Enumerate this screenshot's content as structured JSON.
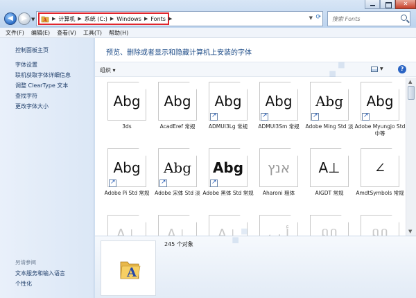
{
  "address_bar": {
    "crumbs": [
      "计算机",
      "系统 (C:)",
      "Windows",
      "Fonts"
    ]
  },
  "search": {
    "placeholder": "搜索 Fonts"
  },
  "menu": [
    "文件(F)",
    "编辑(E)",
    "查看(V)",
    "工具(T)",
    "帮助(H)"
  ],
  "sidebar": {
    "top_links": [
      "控制面板主页"
    ],
    "links": [
      "字体设置",
      "联机获取字体详细信息",
      "调整 ClearType 文本",
      "查找字符",
      "更改字体大小"
    ],
    "see_also_title": "另请参阅",
    "see_also": [
      "文本服务和输入语言",
      "个性化"
    ]
  },
  "main": {
    "heading": "预览、删除或者显示和隐藏计算机上安装的字体",
    "organize_label": "组织",
    "status_count": "245 个对象"
  },
  "fonts": [
    {
      "sample": "Abg",
      "label": "3ds",
      "stack": true,
      "shortcut": false
    },
    {
      "sample": "Abg",
      "label": "AcadEref 常规",
      "stack": false,
      "shortcut": false
    },
    {
      "sample": "Abg",
      "label": "ADMUI3Lg 常规",
      "stack": false,
      "shortcut": true
    },
    {
      "sample": "Abg",
      "label": "ADMUI3Sm 常规",
      "stack": false,
      "shortcut": true
    },
    {
      "sample": "Abg",
      "label": "Adobe Ming Std 淡",
      "stack": false,
      "shortcut": true
    },
    {
      "sample": "Abg",
      "label": "Adobe Myungjo Std 中等",
      "stack": false,
      "shortcut": true
    },
    {
      "sample": "Abg",
      "label": "Adobe Pi Std 常规",
      "stack": false,
      "shortcut": true
    },
    {
      "sample": "Abg",
      "label": "Adobe 宋体 Std 淡",
      "stack": false,
      "shortcut": true
    },
    {
      "sample": "Abg",
      "label": "Adobe 黑体 Std 常规",
      "stack": false,
      "shortcut": true
    },
    {
      "sample": "אנץ",
      "label": "Aharoni 粗体",
      "stack": false,
      "shortcut": false
    },
    {
      "sample": "A⊥",
      "label": "AIGDT 常规",
      "stack": false,
      "shortcut": false
    },
    {
      "sample": "∠",
      "label": "AmdtSymbols 常规",
      "stack": false,
      "shortcut": false
    },
    {
      "sample": "A⊥",
      "label": "",
      "stack": false,
      "shortcut": false
    },
    {
      "sample": "A⊥",
      "label": "",
      "stack": false,
      "shortcut": false
    },
    {
      "sample": "A⊥",
      "label": "",
      "stack": false,
      "shortcut": false
    },
    {
      "sample": "أ ب",
      "label": "",
      "stack": false,
      "shortcut": false
    },
    {
      "sample": "ណ",
      "label": "",
      "stack": false,
      "shortcut": false
    },
    {
      "sample": "ណ",
      "label": "",
      "stack": false,
      "shortcut": false
    }
  ],
  "colors": {
    "highlight_box": "#e0262e",
    "heading_text": "#1f4d88",
    "link_text": "#1d3c68"
  }
}
